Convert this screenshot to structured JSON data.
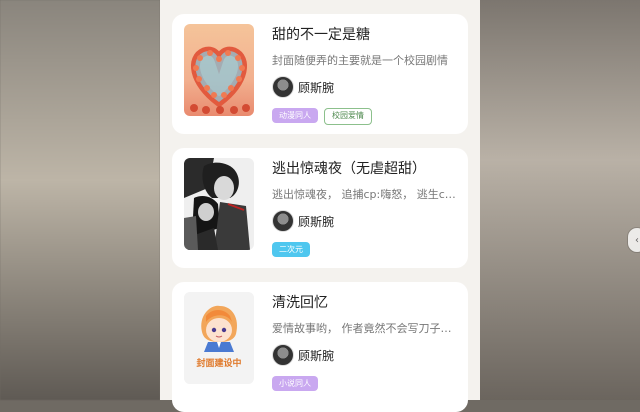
{
  "books": [
    {
      "title": "甜的不一定是糖",
      "description": "封面随便弄的主要就是一个校园剧情",
      "author": "顾斯腕",
      "tags": [
        {
          "label": "动漫同人",
          "style": "purple"
        },
        {
          "label": "校园爱情",
          "style": "outline"
        }
      ],
      "cover": {
        "type": "heart-wreath"
      }
    },
    {
      "title": "逃出惊魂夜（无虐超甜）",
      "description": "逃出惊魂夜，  追捕cp:嗨怒，  逃生cp:…",
      "author": "顾斯腕",
      "tags": [
        {
          "label": "二次元",
          "style": "blue"
        }
      ],
      "cover": {
        "type": "manga"
      }
    },
    {
      "title": "清洗回忆",
      "description": "爱情故事哟，  作者竟然不会写刀子，  但…",
      "author": "顾斯腕",
      "tags": [
        {
          "label": "小说同人",
          "style": "purple"
        }
      ],
      "cover": {
        "type": "placeholder",
        "label": "封面建设中"
      }
    }
  ],
  "colors": {
    "tag_purple": "#c9a8f0",
    "tag_blue": "#4fc7ef",
    "tag_outline": "#8cc08c",
    "placeholder_text": "#e07a2c"
  }
}
